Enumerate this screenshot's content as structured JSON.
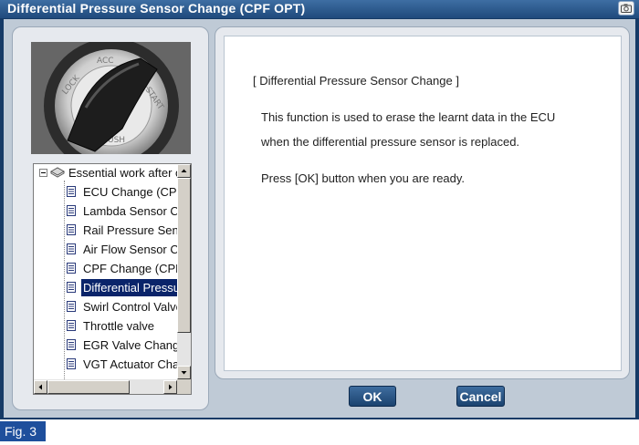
{
  "window": {
    "title": "Differential Pressure Sensor Change (CPF OPT)",
    "camera_icon": "camera-icon"
  },
  "tree": {
    "root_label": "Essential work after c",
    "items": [
      {
        "label": "ECU Change (CPF",
        "selected": false
      },
      {
        "label": "Lambda Sensor C",
        "selected": false
      },
      {
        "label": "Rail Pressure Sen",
        "selected": false
      },
      {
        "label": "Air Flow Sensor C",
        "selected": false
      },
      {
        "label": "CPF Change (CPF",
        "selected": false
      },
      {
        "label": "Differential Pressu",
        "selected": true
      },
      {
        "label": "Swirl Control Valve",
        "selected": false
      },
      {
        "label": "Throttle valve",
        "selected": false
      },
      {
        "label": "EGR Valve Chang",
        "selected": false
      },
      {
        "label": "VGT Actuator Cha",
        "selected": false
      }
    ]
  },
  "message": {
    "heading": "[ Differential Pressure Sensor Change ]",
    "line1": "This function is used to erase the learnt data in the ECU",
    "line2": "when the differential pressure sensor is replaced.",
    "line3": "Press [OK] button when you are ready."
  },
  "buttons": {
    "ok_label": "OK",
    "cancel_label": "Cancel"
  },
  "figure": {
    "label": "Fig. 3"
  },
  "colors": {
    "title_bar": "#1f4a7c",
    "selection": "#0a246a",
    "button": "#1b436f",
    "figure_label_bg": "#1e4f9c"
  }
}
